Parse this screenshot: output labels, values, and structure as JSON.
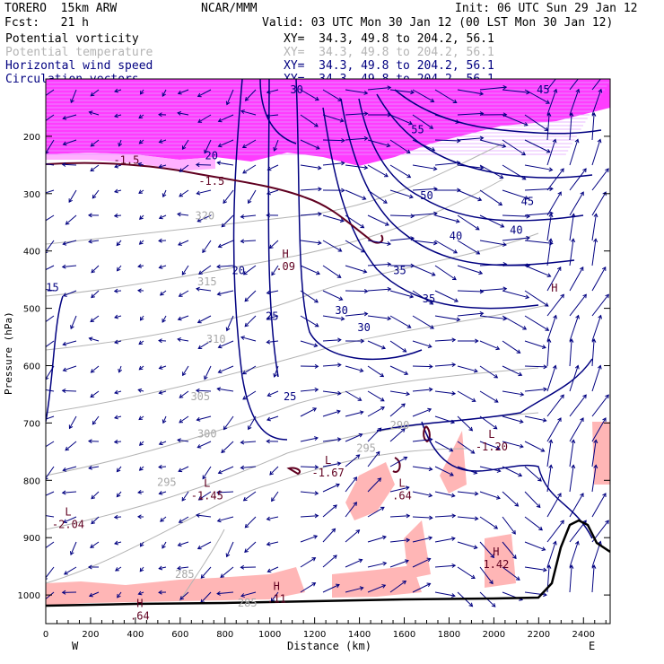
{
  "header": {
    "model": "TORERO  15km ARW",
    "org": "NCAR/MMM",
    "init": "Init: 06 UTC Sun 29 Jan 12",
    "fcst": "Fcst:   21 h",
    "valid": "Valid: 03 UTC Mon 30 Jan 12 (00 LST Mon 30 Jan 12)",
    "fields": [
      {
        "name": "Potential vorticity",
        "xy": "XY=  34.3, 49.8 to 204.2, 56.1",
        "color": "#000000"
      },
      {
        "name": "Potential temperature",
        "xy": "XY=  34.3, 49.8 to 204.2, 56.1",
        "color": "#b4b4b4"
      },
      {
        "name": "Horizontal wind speed",
        "xy": "XY=  34.3, 49.8 to 204.2, 56.1",
        "color": "#000080"
      },
      {
        "name": "Circulation vectors",
        "xy": "XY=  34.3, 49.8 to 204.2, 56.1",
        "color": "#000080"
      }
    ]
  },
  "chart_data": {
    "type": "cross-section",
    "xlabel": "Distance (km)",
    "ylabel": "Pressure (hPa)",
    "xlim": [
      0,
      2540
    ],
    "ylim": [
      1100,
      100
    ],
    "xticks": [
      0,
      200,
      400,
      600,
      800,
      1000,
      1200,
      1400,
      1600,
      1800,
      2000,
      2200,
      2400
    ],
    "yticks": [
      200,
      300,
      400,
      500,
      600,
      700,
      800,
      900,
      1000
    ],
    "left_label": "W",
    "right_label": "E",
    "wind_speed_labels": [
      {
        "v": "20",
        "x": 860,
        "p": 440
      },
      {
        "v": "25",
        "x": 1010,
        "p": 520
      },
      {
        "v": "25",
        "x": 1090,
        "p": 660
      },
      {
        "v": "30",
        "x": 1320,
        "p": 510
      },
      {
        "v": "30",
        "x": 1420,
        "p": 540
      },
      {
        "v": "35",
        "x": 1710,
        "p": 490
      },
      {
        "v": "35",
        "x": 1580,
        "p": 440
      },
      {
        "v": "40",
        "x": 1830,
        "p": 380
      },
      {
        "v": "40",
        "x": 2100,
        "p": 370
      },
      {
        "v": "45",
        "x": 2150,
        "p": 320
      },
      {
        "v": "50",
        "x": 1700,
        "p": 310
      },
      {
        "v": "55",
        "x": 1660,
        "p": 195
      },
      {
        "v": "30",
        "x": 1120,
        "p": 125
      },
      {
        "v": "20",
        "x": 740,
        "p": 240
      },
      {
        "v": "15",
        "x": 30,
        "p": 470
      },
      {
        "v": "45",
        "x": 2220,
        "p": 125
      }
    ],
    "theta_labels": [
      {
        "v": "320",
        "x": 710,
        "p": 345
      },
      {
        "v": "315",
        "x": 720,
        "p": 460
      },
      {
        "v": "310",
        "x": 760,
        "p": 560
      },
      {
        "v": "305",
        "x": 690,
        "p": 660
      },
      {
        "v": "300",
        "x": 720,
        "p": 725
      },
      {
        "v": "295",
        "x": 540,
        "p": 810
      },
      {
        "v": "295",
        "x": 1430,
        "p": 750
      },
      {
        "v": "285",
        "x": 620,
        "p": 970
      },
      {
        "v": "285",
        "x": 900,
        "p": 1020
      },
      {
        "v": "290",
        "x": 1580,
        "p": 710
      }
    ],
    "pv_labels": [
      {
        "v": "-1.5",
        "x": 360,
        "p": 248
      },
      {
        "v": "-1.5",
        "x": 740,
        "p": 285
      }
    ],
    "extrema": [
      {
        "type": "H",
        "value": ".09",
        "x": 1070,
        "p": 430
      },
      {
        "type": "L",
        "value": "-1.67",
        "x": 1260,
        "p": 790
      },
      {
        "type": "L",
        "value": "-1.45",
        "x": 720,
        "p": 830
      },
      {
        "type": "L",
        "value": "-2.04",
        "x": 100,
        "p": 880
      },
      {
        "type": "L",
        "value": ".64",
        "x": 1590,
        "p": 830
      },
      {
        "type": "L",
        "value": "-1.20",
        "x": 1990,
        "p": 745
      },
      {
        "type": "H",
        "value": ".64",
        "x": 420,
        "p": 1040
      },
      {
        "type": "H",
        "value": ".11",
        "x": 1030,
        "p": 1010
      },
      {
        "type": "H",
        "value": "1.42",
        "x": 2010,
        "p": 950
      },
      {
        "type": "H",
        "value": "",
        "x": 2270,
        "p": 490
      }
    ]
  }
}
